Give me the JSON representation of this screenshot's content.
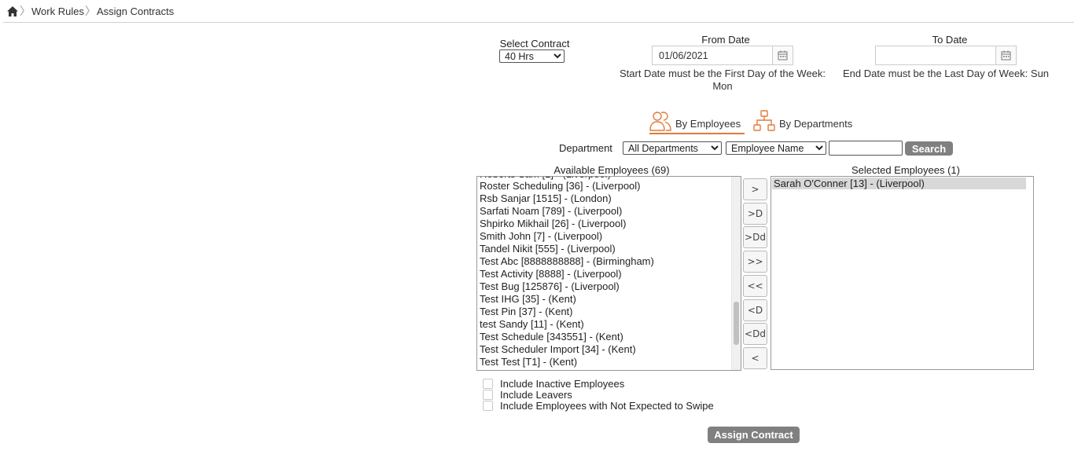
{
  "breadcrumb": {
    "home_icon": "home-icon",
    "items": [
      "Work Rules",
      "Assign Contracts"
    ]
  },
  "contract": {
    "label": "Select Contract",
    "selected": "40 Hrs"
  },
  "from_date": {
    "label": "From Date",
    "value": "01/06/2021",
    "hint": "Start Date must be the First Day of the Week: Mon"
  },
  "to_date": {
    "label": "To Date",
    "value": "",
    "hint": "End Date must be the Last Day of Week: Sun"
  },
  "tabs": [
    {
      "label": "By Employees",
      "icon": "users-icon",
      "active": true
    },
    {
      "label": "By Departments",
      "icon": "org-chart-icon",
      "active": false
    }
  ],
  "filter": {
    "department_label": "Department",
    "department_selected": "All Departments",
    "sort_selected": "Employee Name",
    "search_value": "",
    "search_button": "Search"
  },
  "available": {
    "title": "Available Employees (69)",
    "scroll_fraction": 0.83,
    "items": [
      "Roster Scheduling [36] - (Liverpool)",
      "Rsb Sanjar [1515] - (London)",
      "Sarfati Noam [789] - (Liverpool)",
      "Shpirko Mikhail [26] - (Liverpool)",
      "Smith John [7] - (Liverpool)",
      "Tandel Nikit [555] - (Liverpool)",
      "Test Abc [8888888888] - (Birmingham)",
      "Test Activity [8888] - (Liverpool)",
      "Test Bug [125876] - (Liverpool)",
      "Test IHG [35] - (Kent)",
      "Test Pin [37] - (Kent)",
      "test Sandy [11] - (Kent)",
      "Test Schedule [343551] - (Kent)",
      "Test Scheduler Import [34] - (Kent)",
      "Test Test [T1] - (Kent)"
    ]
  },
  "move_buttons": [
    ">",
    ">D",
    ">Dd",
    ">>",
    "<<",
    "<D",
    "<Dd",
    "<"
  ],
  "selected": {
    "title": "Selected Employees (1)",
    "items": [
      "Sarah O'Conner [13] - (Liverpool)"
    ]
  },
  "options": [
    {
      "label": "Include Inactive Employees",
      "checked": false
    },
    {
      "label": "Include Leavers",
      "checked": false
    },
    {
      "label": "Include Employees with Not Expected to Swipe",
      "checked": false
    }
  ],
  "assign_button": "Assign Contract",
  "colors": {
    "accent": "#e07a3c",
    "button_gray": "#808080"
  }
}
